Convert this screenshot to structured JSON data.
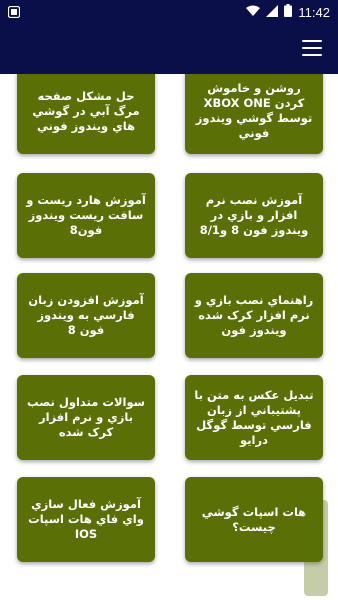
{
  "status_bar": {
    "time": "11:42",
    "icons": [
      "app-notification-icon",
      "wifi-icon",
      "signal-icon",
      "battery-icon"
    ]
  },
  "app_bar": {
    "menu_icon": "hamburger-menu-icon"
  },
  "colors": {
    "app_bar": "#0a0f4a",
    "card": "#5a7006",
    "card_text": "#ffffff",
    "background": "#ffffff"
  },
  "cards": [
    {
      "label": "روشن و خاموش کردن XBOX ONE توسط گوشي ويندوز فوني"
    },
    {
      "label": "حل مشکل صفحه مرگ آبي در گوشي هاي ويندوز فوني"
    },
    {
      "label": "آموزش نصب نرم افزار و بازي در ويندوز فون 8 و8/1"
    },
    {
      "label": "آموزش هارد ريست و سافت ريست ويندوز فون8"
    },
    {
      "label": "راهنماي نصب بازي و نرم افزار کرک شده ويندوز فون"
    },
    {
      "label": "آموزش افزودن زبان فارسي به ويندوز فون 8"
    },
    {
      "label": "تبديل عکس به متن با پشتيباني از زبان فارسي توسط گوگل درايو"
    },
    {
      "label": "سوالات متداول نصب بازي و نرم افزار کرک شده"
    },
    {
      "label": "هات اسپات گوشي چيست؟"
    },
    {
      "label": "آموزش فعال سازي واي فاي هات اسپات IOS"
    }
  ]
}
